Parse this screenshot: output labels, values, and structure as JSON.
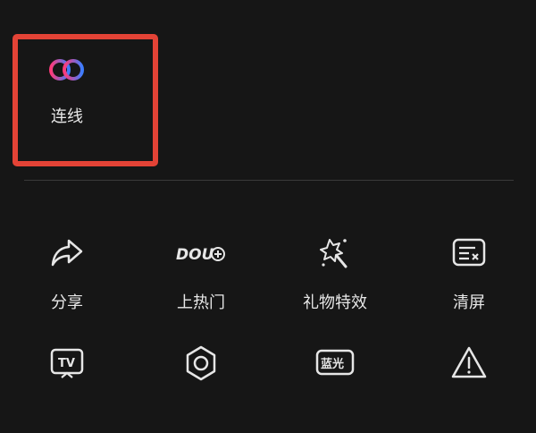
{
  "featured": {
    "label": "连线",
    "icon": "link-rings-icon"
  },
  "grid_row1": [
    {
      "label": "分享",
      "icon": "share-arrow-icon"
    },
    {
      "label": "上热门",
      "icon": "dou-plus-icon",
      "icon_text": "DOU"
    },
    {
      "label": "礼物特效",
      "icon": "gift-effect-icon"
    },
    {
      "label": "清屏",
      "icon": "clear-screen-icon"
    }
  ],
  "grid_row2": [
    {
      "icon": "tv-cast-icon",
      "icon_text": "TV"
    },
    {
      "icon": "hexagon-settings-icon"
    },
    {
      "icon": "blue-light-icon",
      "icon_text": "蓝光"
    },
    {
      "icon": "warning-report-icon"
    }
  ],
  "colors": {
    "highlight": "#e34336",
    "background": "#161616",
    "link_gradient": [
      "#ff3a7a",
      "#3c7dff"
    ]
  }
}
